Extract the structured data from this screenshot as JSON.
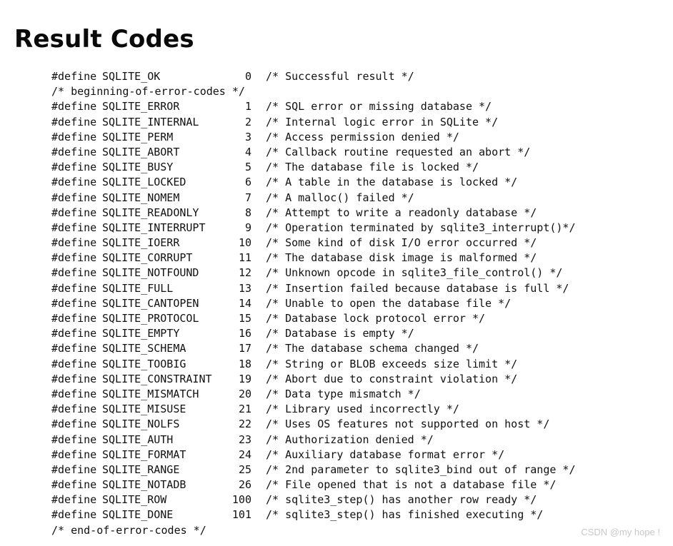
{
  "page": {
    "title": "Result Codes",
    "background_color": "#ffffff",
    "text_color": "#111111"
  },
  "watermark": {
    "text": "CSDN @my hope !",
    "color": "#c8c8c8"
  },
  "code": {
    "directive": "#define",
    "lines": [
      {
        "kind": "define",
        "directive": "#define",
        "name": "SQLITE_OK",
        "value": "0",
        "comment": "/* Successful result */"
      },
      {
        "kind": "comment",
        "text": "/* beginning-of-error-codes */"
      },
      {
        "kind": "define",
        "directive": "#define",
        "name": "SQLITE_ERROR",
        "value": "1",
        "comment": "/* SQL error or missing database */"
      },
      {
        "kind": "define",
        "directive": "#define",
        "name": "SQLITE_INTERNAL",
        "value": "2",
        "comment": "/* Internal logic error in SQLite */"
      },
      {
        "kind": "define",
        "directive": "#define",
        "name": "SQLITE_PERM",
        "value": "3",
        "comment": "/* Access permission denied */"
      },
      {
        "kind": "define",
        "directive": "#define",
        "name": "SQLITE_ABORT",
        "value": "4",
        "comment": "/* Callback routine requested an abort */"
      },
      {
        "kind": "define",
        "directive": "#define",
        "name": "SQLITE_BUSY",
        "value": "5",
        "comment": "/* The database file is locked */"
      },
      {
        "kind": "define",
        "directive": "#define",
        "name": "SQLITE_LOCKED",
        "value": "6",
        "comment": "/* A table in the database is locked */"
      },
      {
        "kind": "define",
        "directive": "#define",
        "name": "SQLITE_NOMEM",
        "value": "7",
        "comment": "/* A malloc() failed */"
      },
      {
        "kind": "define",
        "directive": "#define",
        "name": "SQLITE_READONLY",
        "value": "8",
        "comment": "/* Attempt to write a readonly database */"
      },
      {
        "kind": "define",
        "directive": "#define",
        "name": "SQLITE_INTERRUPT",
        "value": "9",
        "comment": "/* Operation terminated by sqlite3_interrupt()*/"
      },
      {
        "kind": "define",
        "directive": "#define",
        "name": "SQLITE_IOERR",
        "value": "10",
        "comment": "/* Some kind of disk I/O error occurred */"
      },
      {
        "kind": "define",
        "directive": "#define",
        "name": "SQLITE_CORRUPT",
        "value": "11",
        "comment": "/* The database disk image is malformed */"
      },
      {
        "kind": "define",
        "directive": "#define",
        "name": "SQLITE_NOTFOUND",
        "value": "12",
        "comment": "/* Unknown opcode in sqlite3_file_control() */"
      },
      {
        "kind": "define",
        "directive": "#define",
        "name": "SQLITE_FULL",
        "value": "13",
        "comment": "/* Insertion failed because database is full */"
      },
      {
        "kind": "define",
        "directive": "#define",
        "name": "SQLITE_CANTOPEN",
        "value": "14",
        "comment": "/* Unable to open the database file */"
      },
      {
        "kind": "define",
        "directive": "#define",
        "name": "SQLITE_PROTOCOL",
        "value": "15",
        "comment": "/* Database lock protocol error */"
      },
      {
        "kind": "define",
        "directive": "#define",
        "name": "SQLITE_EMPTY",
        "value": "16",
        "comment": "/* Database is empty */"
      },
      {
        "kind": "define",
        "directive": "#define",
        "name": "SQLITE_SCHEMA",
        "value": "17",
        "comment": "/* The database schema changed */"
      },
      {
        "kind": "define",
        "directive": "#define",
        "name": "SQLITE_TOOBIG",
        "value": "18",
        "comment": "/* String or BLOB exceeds size limit */"
      },
      {
        "kind": "define",
        "directive": "#define",
        "name": "SQLITE_CONSTRAINT",
        "value": "19",
        "comment": "/* Abort due to constraint violation */"
      },
      {
        "kind": "define",
        "directive": "#define",
        "name": "SQLITE_MISMATCH",
        "value": "20",
        "comment": "/* Data type mismatch */"
      },
      {
        "kind": "define",
        "directive": "#define",
        "name": "SQLITE_MISUSE",
        "value": "21",
        "comment": "/* Library used incorrectly */"
      },
      {
        "kind": "define",
        "directive": "#define",
        "name": "SQLITE_NOLFS",
        "value": "22",
        "comment": "/* Uses OS features not supported on host */"
      },
      {
        "kind": "define",
        "directive": "#define",
        "name": "SQLITE_AUTH",
        "value": "23",
        "comment": "/* Authorization denied */"
      },
      {
        "kind": "define",
        "directive": "#define",
        "name": "SQLITE_FORMAT",
        "value": "24",
        "comment": "/* Auxiliary database format error */"
      },
      {
        "kind": "define",
        "directive": "#define",
        "name": "SQLITE_RANGE",
        "value": "25",
        "comment": "/* 2nd parameter to sqlite3_bind out of range */"
      },
      {
        "kind": "define",
        "directive": "#define",
        "name": "SQLITE_NOTADB",
        "value": "26",
        "comment": "/* File opened that is not a database file */"
      },
      {
        "kind": "define",
        "directive": "#define",
        "name": "SQLITE_ROW",
        "value": "100",
        "comment": "/* sqlite3_step() has another row ready */"
      },
      {
        "kind": "define",
        "directive": "#define",
        "name": "SQLITE_DONE",
        "value": "101",
        "comment": "/* sqlite3_step() has finished executing */"
      },
      {
        "kind": "comment",
        "text": "/* end-of-error-codes */"
      }
    ]
  }
}
